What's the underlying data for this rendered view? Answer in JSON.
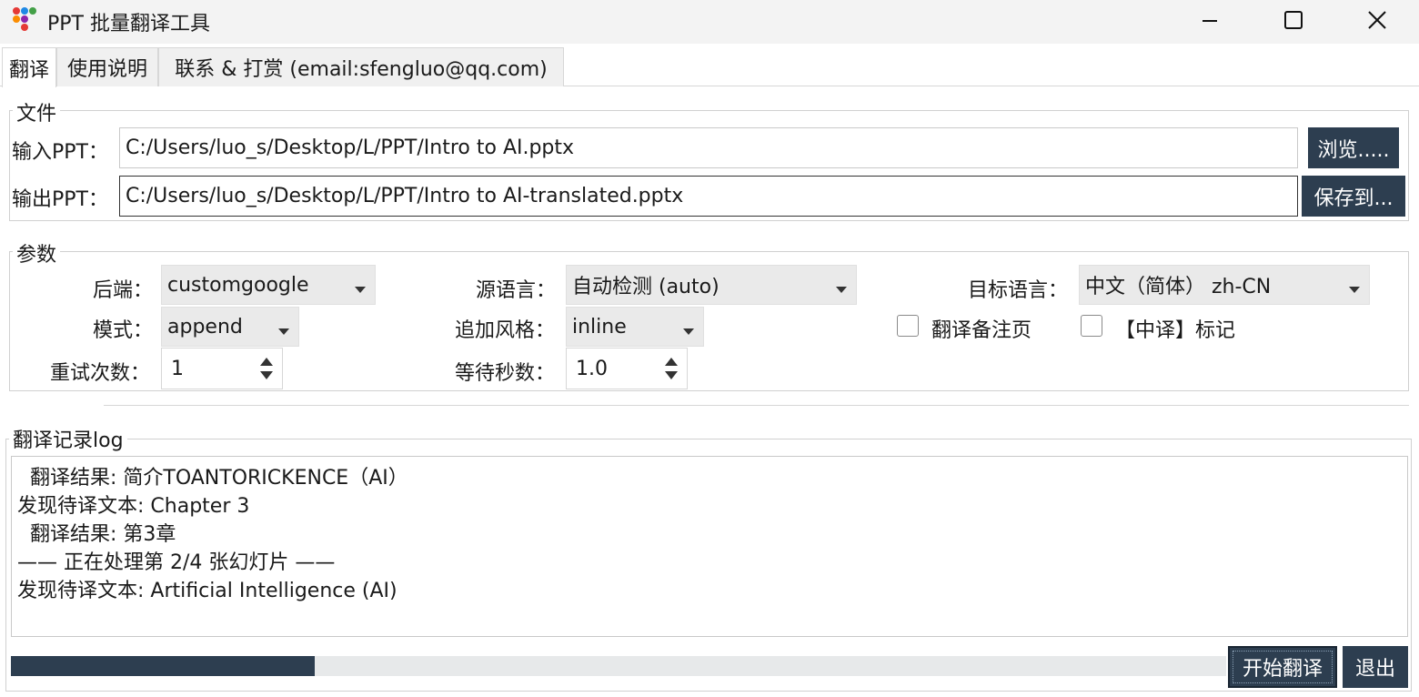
{
  "window": {
    "title": "PPT 批量翻译工具",
    "minimize_glyph": "—",
    "maximize_glyph": "☐",
    "close_glyph": "✕"
  },
  "tabs": [
    {
      "label": "翻译",
      "active": true
    },
    {
      "label": "使用说明",
      "active": false
    },
    {
      "label": "联系 & 打赏 (email:sfengluo@qq.com)",
      "active": false
    }
  ],
  "file_group": {
    "title": "文件",
    "input_label": "输入PPT：",
    "input_value": "C:/Users/luo_s/Desktop/L/PPT/Intro to AI.pptx",
    "browse_label": "浏览.....",
    "output_label": "输出PPT：",
    "output_value": "C:/Users/luo_s/Desktop/L/PPT/Intro to AI-translated.pptx",
    "save_label": "保存到..."
  },
  "params_group": {
    "title": "参数",
    "backend_label": "后端：",
    "backend_value": "customgoogle",
    "source_lang_label": "源语言：",
    "source_lang_value": "自动检测 (auto)",
    "target_lang_label": "目标语言：",
    "target_lang_value": "中文（简体） zh-CN",
    "mode_label": "模式：",
    "mode_value": "append",
    "append_style_label": "追加风格：",
    "append_style_value": "inline",
    "translate_notes_label": "翻译备注页",
    "translate_notes_checked": false,
    "mark_label": "【中译】标记",
    "mark_checked": false,
    "retries_label": "重试次数：",
    "retries_value": "1",
    "wait_label": "等待秒数：",
    "wait_value": "1.0"
  },
  "log_group": {
    "title": "翻译记录log",
    "lines": [
      "  翻译结果: 简介TOANTORICKENCE（AI）",
      "发现待译文本: Chapter 3",
      "  翻译结果: 第3章",
      "—— 正在处理第 2/4 张幻灯片 ——",
      "发现待译文本: Artificial Intelligence (AI)"
    ]
  },
  "progress": {
    "fraction": 0.25
  },
  "actions": {
    "start_label": "开始翻译",
    "exit_label": "退出"
  },
  "colors": {
    "dark_button": "#2d3e50",
    "progress_fill": "#2d3e50",
    "progress_track": "#e7e9ea"
  }
}
